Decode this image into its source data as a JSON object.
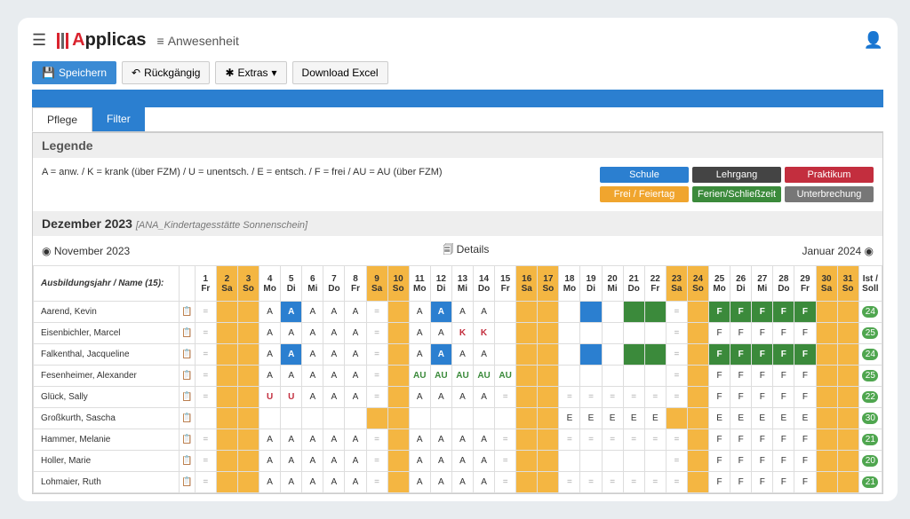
{
  "app": {
    "name_part1": "A",
    "name_part2": "pplicas",
    "breadcrumb": "Anwesenheit"
  },
  "toolbar": {
    "save": "Speichern",
    "undo": "Rückgängig",
    "extras": "Extras",
    "download": "Download Excel"
  },
  "tabs": {
    "pflege": "Pflege",
    "filter": "Filter"
  },
  "legend": {
    "title": "Legende",
    "text": "A = anw. / K = krank (über FZM) / U = unentsch. / E = entsch. / F = frei / AU = AU (über FZM)",
    "badges": [
      "Schule",
      "Lehrgang",
      "Praktikum",
      "Frei / Feiertag",
      "Ferien/Schließzeit",
      "Unterbrechung"
    ]
  },
  "month": {
    "title": "Dezember 2023",
    "sub": "[ANA_Kindertagesstätte Sonnenschein]",
    "prev": "November 2023",
    "details": "Details",
    "next": "Januar 2024"
  },
  "header_name": "Ausbildungsjahr / Name (15):",
  "sum_headers": [
    "Ist /",
    "Soll"
  ],
  "days": [
    {
      "n": "1",
      "w": "Fr",
      "we": false
    },
    {
      "n": "2",
      "w": "Sa",
      "we": true
    },
    {
      "n": "3",
      "w": "So",
      "we": true
    },
    {
      "n": "4",
      "w": "Mo",
      "we": false
    },
    {
      "n": "5",
      "w": "Di",
      "we": false
    },
    {
      "n": "6",
      "w": "Mi",
      "we": false
    },
    {
      "n": "7",
      "w": "Do",
      "we": false
    },
    {
      "n": "8",
      "w": "Fr",
      "we": false
    },
    {
      "n": "9",
      "w": "Sa",
      "we": true
    },
    {
      "n": "10",
      "w": "So",
      "we": true
    },
    {
      "n": "11",
      "w": "Mo",
      "we": false
    },
    {
      "n": "12",
      "w": "Di",
      "we": false
    },
    {
      "n": "13",
      "w": "Mi",
      "we": false
    },
    {
      "n": "14",
      "w": "Do",
      "we": false
    },
    {
      "n": "15",
      "w": "Fr",
      "we": false
    },
    {
      "n": "16",
      "w": "Sa",
      "we": true
    },
    {
      "n": "17",
      "w": "So",
      "we": true
    },
    {
      "n": "18",
      "w": "Mo",
      "we": false
    },
    {
      "n": "19",
      "w": "Di",
      "we": false
    },
    {
      "n": "20",
      "w": "Mi",
      "we": false
    },
    {
      "n": "21",
      "w": "Do",
      "we": false
    },
    {
      "n": "22",
      "w": "Fr",
      "we": false
    },
    {
      "n": "23",
      "w": "Sa",
      "we": true
    },
    {
      "n": "24",
      "w": "So",
      "we": true
    },
    {
      "n": "25",
      "w": "Mo",
      "we": false
    },
    {
      "n": "26",
      "w": "Di",
      "we": false
    },
    {
      "n": "27",
      "w": "Mi",
      "we": false
    },
    {
      "n": "28",
      "w": "Do",
      "we": false
    },
    {
      "n": "29",
      "w": "Fr",
      "we": false
    },
    {
      "n": "30",
      "w": "Sa",
      "we": true
    },
    {
      "n": "31",
      "w": "So",
      "we": true
    }
  ],
  "rows": [
    {
      "name": "Aarend, Kevin",
      "sum": "24",
      "cells": [
        "=",
        "",
        "",
        "A",
        "Ab",
        "A",
        "A",
        "A",
        "=",
        "",
        "A",
        "Ab",
        "A",
        "A",
        "",
        "",
        "",
        "",
        "b",
        "",
        "g",
        "g",
        "=",
        "",
        "Fg",
        "Fg",
        "Fg",
        "Fg",
        "Fg",
        "",
        ""
      ]
    },
    {
      "name": "Eisenbichler, Marcel",
      "sum": "25",
      "cells": [
        "=",
        "",
        "",
        "A",
        "A",
        "A",
        "A",
        "A",
        "=",
        "",
        "A",
        "A",
        "K",
        "K",
        "",
        "",
        "",
        "",
        "",
        "",
        "",
        "",
        "=",
        "",
        "F",
        "F",
        "F",
        "F",
        "F",
        "",
        ""
      ]
    },
    {
      "name": "Falkenthal, Jacqueline",
      "sum": "24",
      "cells": [
        "=",
        "",
        "",
        "A",
        "Ab",
        "A",
        "A",
        "A",
        "=",
        "",
        "A",
        "Ab",
        "A",
        "A",
        "",
        "",
        "",
        "",
        "b",
        "",
        "g",
        "g",
        "=",
        "",
        "Fg",
        "Fg",
        "Fg",
        "Fg",
        "Fg",
        "",
        ""
      ]
    },
    {
      "name": "Fesenheimer, Alexander",
      "sum": "25",
      "cells": [
        "=",
        "",
        "",
        "A",
        "A",
        "A",
        "A",
        "A",
        "=",
        "",
        "AU",
        "AU",
        "AU",
        "AU",
        "AU",
        "",
        "",
        "",
        "",
        "",
        "",
        "",
        "=",
        "",
        "F",
        "F",
        "F",
        "F",
        "F",
        "",
        ""
      ]
    },
    {
      "name": "Glück, Sally",
      "sum": "22",
      "cells": [
        "=",
        "",
        "",
        "U",
        "U",
        "A",
        "A",
        "A",
        "=",
        "",
        "A",
        "A",
        "A",
        "A",
        "=",
        "",
        "",
        "=",
        "=",
        "=",
        "=",
        "=",
        "=",
        "",
        "F",
        "F",
        "F",
        "F",
        "F",
        "",
        ""
      ]
    },
    {
      "name": "Großkurth, Sascha",
      "sum": "30",
      "cells": [
        "",
        "",
        "",
        "",
        "",
        "",
        "",
        "",
        "",
        "",
        "",
        "",
        "",
        "",
        "",
        "",
        "",
        "E",
        "E",
        "E",
        "E",
        "E",
        "",
        "",
        "E",
        "E",
        "E",
        "E",
        "E",
        "",
        ""
      ]
    },
    {
      "name": "Hammer, Melanie",
      "sum": "21",
      "cells": [
        "=",
        "",
        "",
        "A",
        "A",
        "A",
        "A",
        "A",
        "=",
        "",
        "A",
        "A",
        "A",
        "A",
        "=",
        "",
        "",
        "=",
        "=",
        "=",
        "=",
        "=",
        "=",
        "",
        "F",
        "F",
        "F",
        "F",
        "F",
        "",
        ""
      ]
    },
    {
      "name": "Holler, Marie",
      "sum": "20",
      "cells": [
        "=",
        "",
        "",
        "A",
        "A",
        "A",
        "A",
        "A",
        "=",
        "",
        "A",
        "A",
        "A",
        "A",
        "=",
        "",
        "",
        "",
        "",
        "",
        "",
        "",
        "=",
        "",
        "F",
        "F",
        "F",
        "F",
        "F",
        "",
        ""
      ]
    },
    {
      "name": "Lohmaier, Ruth",
      "sum": "21",
      "cells": [
        "=",
        "",
        "",
        "A",
        "A",
        "A",
        "A",
        "A",
        "=",
        "",
        "A",
        "A",
        "A",
        "A",
        "=",
        "",
        "",
        "=",
        "=",
        "=",
        "=",
        "=",
        "=",
        "",
        "F",
        "F",
        "F",
        "F",
        "F",
        "",
        ""
      ]
    }
  ]
}
